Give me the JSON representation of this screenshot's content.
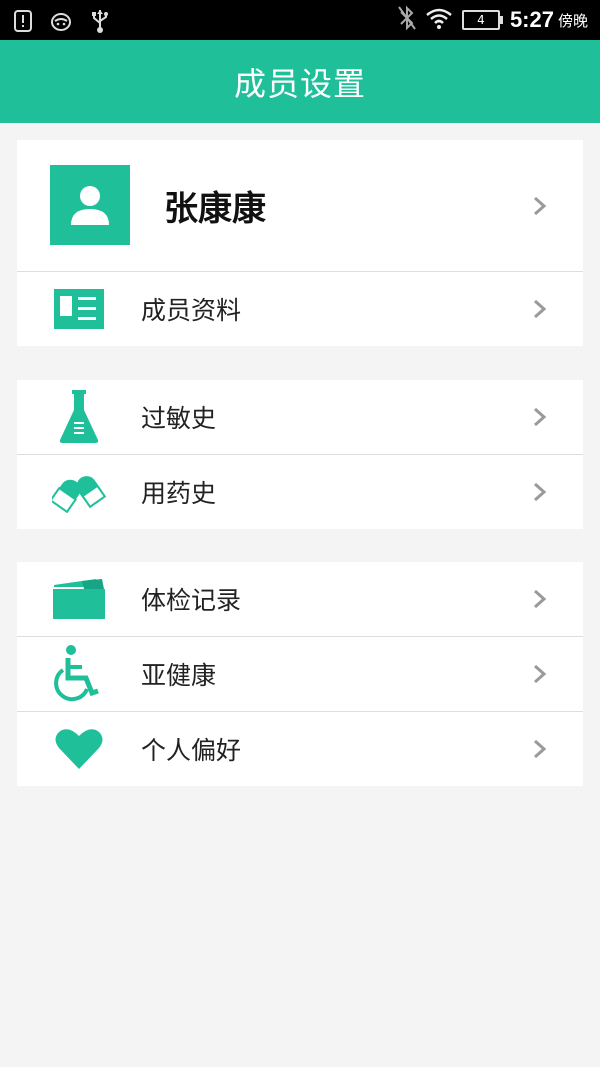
{
  "status_bar": {
    "time": "5:27",
    "period": "傍晚",
    "battery": "4",
    "icons": [
      "alert-icon",
      "cat-icon",
      "usb-icon",
      "bluetooth-icon",
      "wifi-icon",
      "battery-icon"
    ]
  },
  "header": {
    "title": "成员设置"
  },
  "profile": {
    "name": "张康康"
  },
  "groups": [
    {
      "items": [
        {
          "label": "成员资料",
          "icon": "id-card-icon"
        }
      ]
    },
    {
      "items": [
        {
          "label": "过敏史",
          "icon": "flask-icon"
        },
        {
          "label": "用药史",
          "icon": "pills-icon"
        }
      ]
    },
    {
      "items": [
        {
          "label": "体检记录",
          "icon": "folder-icon"
        },
        {
          "label": "亚健康",
          "icon": "wheelchair-icon"
        },
        {
          "label": "个人偏好",
          "icon": "heart-icon"
        }
      ]
    }
  ],
  "colors": {
    "accent": "#1fbf9a",
    "background": "#f4f4f4",
    "chevron": "#9a9a9a"
  }
}
